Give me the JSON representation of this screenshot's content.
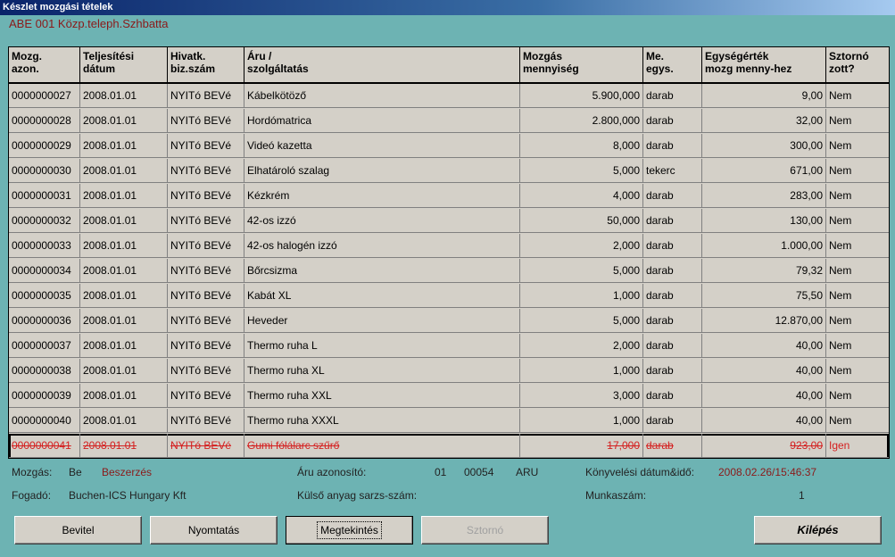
{
  "window": {
    "title": "Készlet mozgási tételek",
    "subtitle": "ABE 001 Közp.teleph.Szhbatta"
  },
  "table": {
    "headers": [
      "Mozg.\nazon.",
      "Teljesítési\ndátum",
      "Hivatk.\nbiz.szám",
      "Áru /\nszolgáltatás",
      "Mozgás\nmennyiség",
      "Me.\negys.",
      "Egységérték\nmozg menny-hez",
      "Sztornó\nzott?"
    ],
    "rows": [
      [
        "0000000027",
        "2008.01.01",
        "NYITó BEVé",
        "Kábelkötöző",
        "5.900,000",
        "darab",
        "9,00",
        "Nem"
      ],
      [
        "0000000028",
        "2008.01.01",
        "NYITó BEVé",
        "Hordómatrica",
        "2.800,000",
        "darab",
        "32,00",
        "Nem"
      ],
      [
        "0000000029",
        "2008.01.01",
        "NYITó BEVé",
        "Videó kazetta",
        "8,000",
        "darab",
        "300,00",
        "Nem"
      ],
      [
        "0000000030",
        "2008.01.01",
        "NYITó BEVé",
        "Elhatároló szalag",
        "5,000",
        "tekerc",
        "671,00",
        "Nem"
      ],
      [
        "0000000031",
        "2008.01.01",
        "NYITó BEVé",
        "Kézkrém",
        "4,000",
        "darab",
        "283,00",
        "Nem"
      ],
      [
        "0000000032",
        "2008.01.01",
        "NYITó BEVé",
        "42-os izzó",
        "50,000",
        "darab",
        "130,00",
        "Nem"
      ],
      [
        "0000000033",
        "2008.01.01",
        "NYITó BEVé",
        "42-os halogén izzó",
        "2,000",
        "darab",
        "1.000,00",
        "Nem"
      ],
      [
        "0000000034",
        "2008.01.01",
        "NYITó BEVé",
        "Bőrcsizma",
        "5,000",
        "darab",
        "79,32",
        "Nem"
      ],
      [
        "0000000035",
        "2008.01.01",
        "NYITó BEVé",
        " Kabát XL",
        "1,000",
        "darab",
        "75,50",
        "Nem"
      ],
      [
        "0000000036",
        "2008.01.01",
        "NYITó BEVé",
        "Heveder",
        "5,000",
        "darab",
        "12.870,00",
        "Nem"
      ],
      [
        "0000000037",
        "2008.01.01",
        "NYITó BEVé",
        "Thermo ruha L",
        "2,000",
        "darab",
        "40,00",
        "Nem"
      ],
      [
        "0000000038",
        "2008.01.01",
        "NYITó BEVé",
        "Thermo ruha XL",
        "1,000",
        "darab",
        "40,00",
        "Nem"
      ],
      [
        "0000000039",
        "2008.01.01",
        "NYITó BEVé",
        "Thermo ruha XXL",
        "3,000",
        "darab",
        "40,00",
        "Nem"
      ],
      [
        "0000000040",
        "2008.01.01",
        "NYITó BEVé",
        "Thermo ruha XXXL",
        "1,000",
        "darab",
        "40,00",
        "Nem"
      ],
      [
        "0000000041",
        "2008.01.01",
        "NYITó BEVé",
        "Gumi fólálarc szűrő",
        "17,000",
        "darab",
        "923,00",
        "Igen"
      ]
    ],
    "storno_row_index": 14
  },
  "info": {
    "mozgas_label": "Mozgás:",
    "mozgas_code": "Be",
    "mozgas_type": "Beszerzés",
    "aru_label": "Áru azonosító:",
    "aru_part1": "01",
    "aru_part2": "00054",
    "aru_part3": "ARU",
    "konyv_label": "Könyvelési dátum&idő:",
    "konyv_value": "2008.02.26/15:46:37",
    "fogado_label": "Fogadó:",
    "fogado_value": "Buchen-ICS Hungary Kft",
    "sarzs_label": "Külső anyag sarzs-szám:",
    "munka_label": "Munkaszám:",
    "munka_value": "1"
  },
  "buttons": {
    "bevitel": "Bevitel",
    "nyomtatas": "Nyomtatás",
    "megtekintes": "Megtekintés",
    "sztorno": "Sztornó",
    "kilepes": "Kilépés"
  },
  "colors": {
    "background": "#6db3b3",
    "grid": "#d4d0c8",
    "storno_text": "#d42020"
  }
}
